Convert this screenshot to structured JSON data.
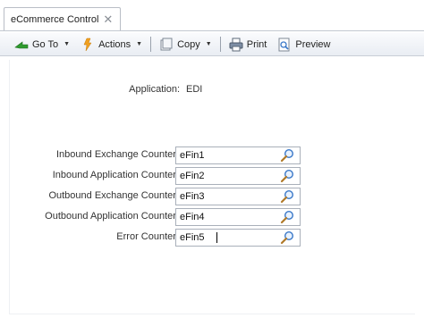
{
  "tab": {
    "label": "eCommerce Control",
    "close": "✕"
  },
  "toolbar": {
    "goto_label": "Go To",
    "actions_label": "Actions",
    "copy_label": "Copy",
    "print_label": "Print",
    "preview_label": "Preview"
  },
  "form": {
    "application_label": "Application:",
    "application_value": "EDI",
    "fields": [
      {
        "label": "Inbound Exchange Counter:",
        "value": "eFin1"
      },
      {
        "label": "Inbound Application Counter:",
        "value": "eFin2"
      },
      {
        "label": "Outbound Exchange Counter:",
        "value": "eFin3"
      },
      {
        "label": "Outbound Application Counter:",
        "value": "eFin4"
      },
      {
        "label": "Error Counter:",
        "value": "eFin5"
      }
    ]
  },
  "icons": {
    "goto": "green-arrow-icon",
    "actions": "lightning-icon",
    "copy": "copy-icon",
    "print": "printer-icon",
    "preview": "preview-icon",
    "lookup": "magnifier-icon"
  },
  "colors": {
    "accent_green": "#2e9a2e",
    "actions_orange": "#f0a020",
    "lookup_blue": "#3a78c8"
  }
}
